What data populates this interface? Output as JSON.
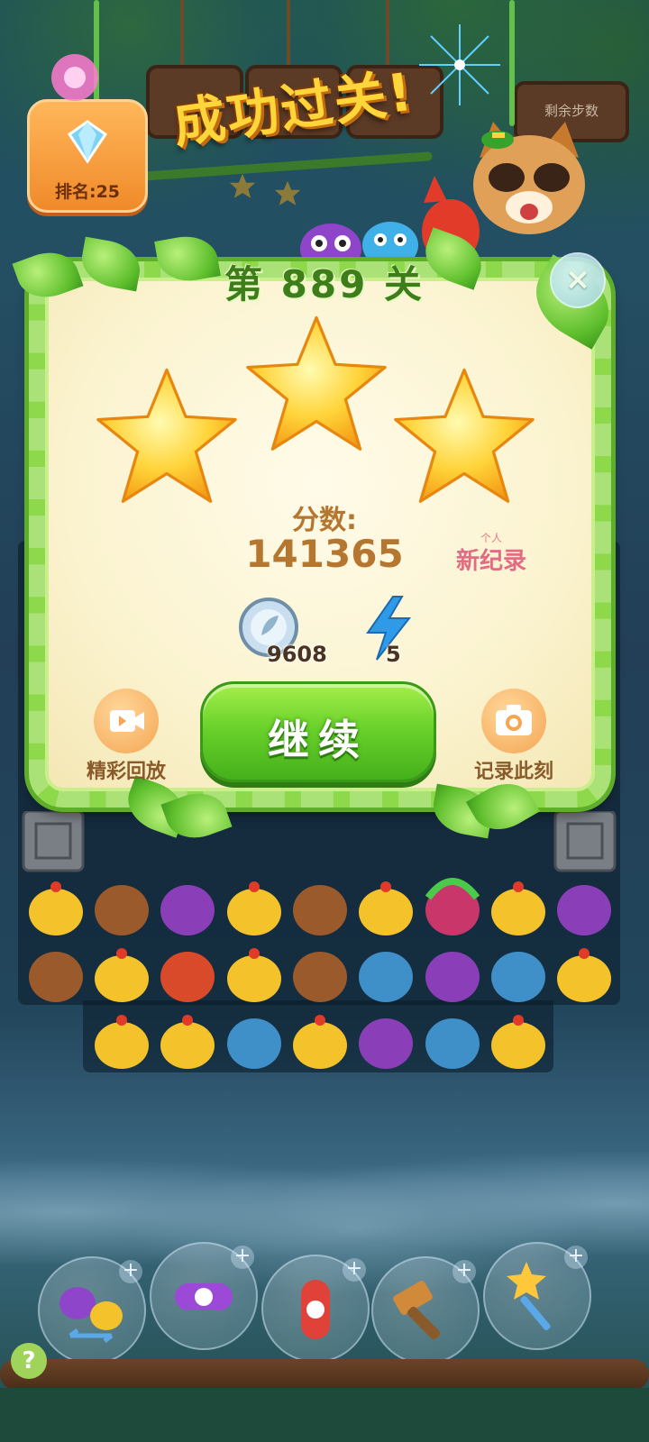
{
  "header": {
    "success_title": "成功过关!",
    "rank_label": "排名:25",
    "remaining_sign": "剩余步数"
  },
  "panel": {
    "level_title": "第 889 关",
    "stars_earned": 3,
    "score_label": "分数:",
    "score_value": "141365",
    "record_top": "个人",
    "record_main": "新纪录",
    "coins": "9608",
    "energy": "5",
    "continue_label": "继续",
    "replay_label": "精彩回放",
    "snapshot_label": "记录此刻",
    "close_label": "×"
  },
  "boosters": [
    {
      "name": "swap-booster"
    },
    {
      "name": "rocket-horizontal-booster"
    },
    {
      "name": "rocket-vertical-booster"
    },
    {
      "name": "hammer-booster"
    },
    {
      "name": "magic-wand-booster"
    }
  ],
  "help_label": "?",
  "colors": {
    "panel_border": "#8ed84b",
    "continue_green": "#6bd22b",
    "score_brown": "#b5772f",
    "title_yellow": "#ffd63a",
    "record_pink": "#e26c83"
  }
}
